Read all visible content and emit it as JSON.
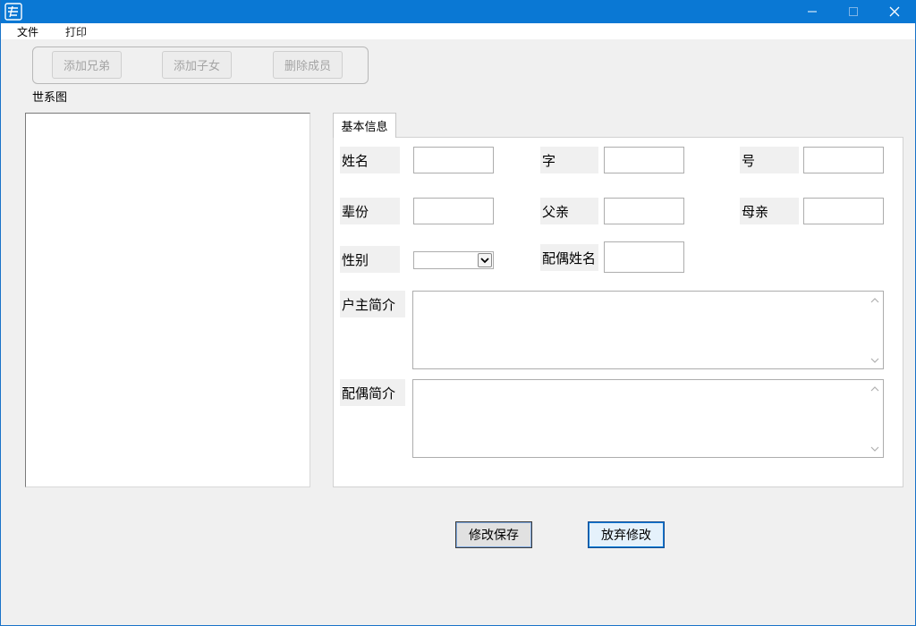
{
  "window": {
    "accent_color": "#0a78d4",
    "controls": {
      "minimize": "minimize-icon",
      "maximize": "maximize-icon",
      "close": "close-icon"
    }
  },
  "menu": {
    "file": "文件",
    "print": "打印"
  },
  "toolbar": {
    "add_sibling": "添加兄弟",
    "add_child": "添加子女",
    "delete_member": "删除成员"
  },
  "tree": {
    "label": "世系图"
  },
  "tab": {
    "basic_info": "基本信息"
  },
  "form": {
    "name_label": "姓名",
    "name_value": "",
    "courtesy_label": "字",
    "courtesy_value": "",
    "alias_label": "号",
    "alias_value": "",
    "generation_label": "辈份",
    "generation_value": "",
    "father_label": "父亲",
    "father_value": "",
    "mother_label": "母亲",
    "mother_value": "",
    "gender_label": "性别",
    "gender_value": "",
    "spouse_name_label": "配偶姓名",
    "spouse_name_value": "",
    "householder_intro_label": "户主简介",
    "householder_intro_value": "",
    "spouse_intro_label": "配偶简介",
    "spouse_intro_value": ""
  },
  "actions": {
    "save": "修改保存",
    "discard": "放弃修改"
  }
}
